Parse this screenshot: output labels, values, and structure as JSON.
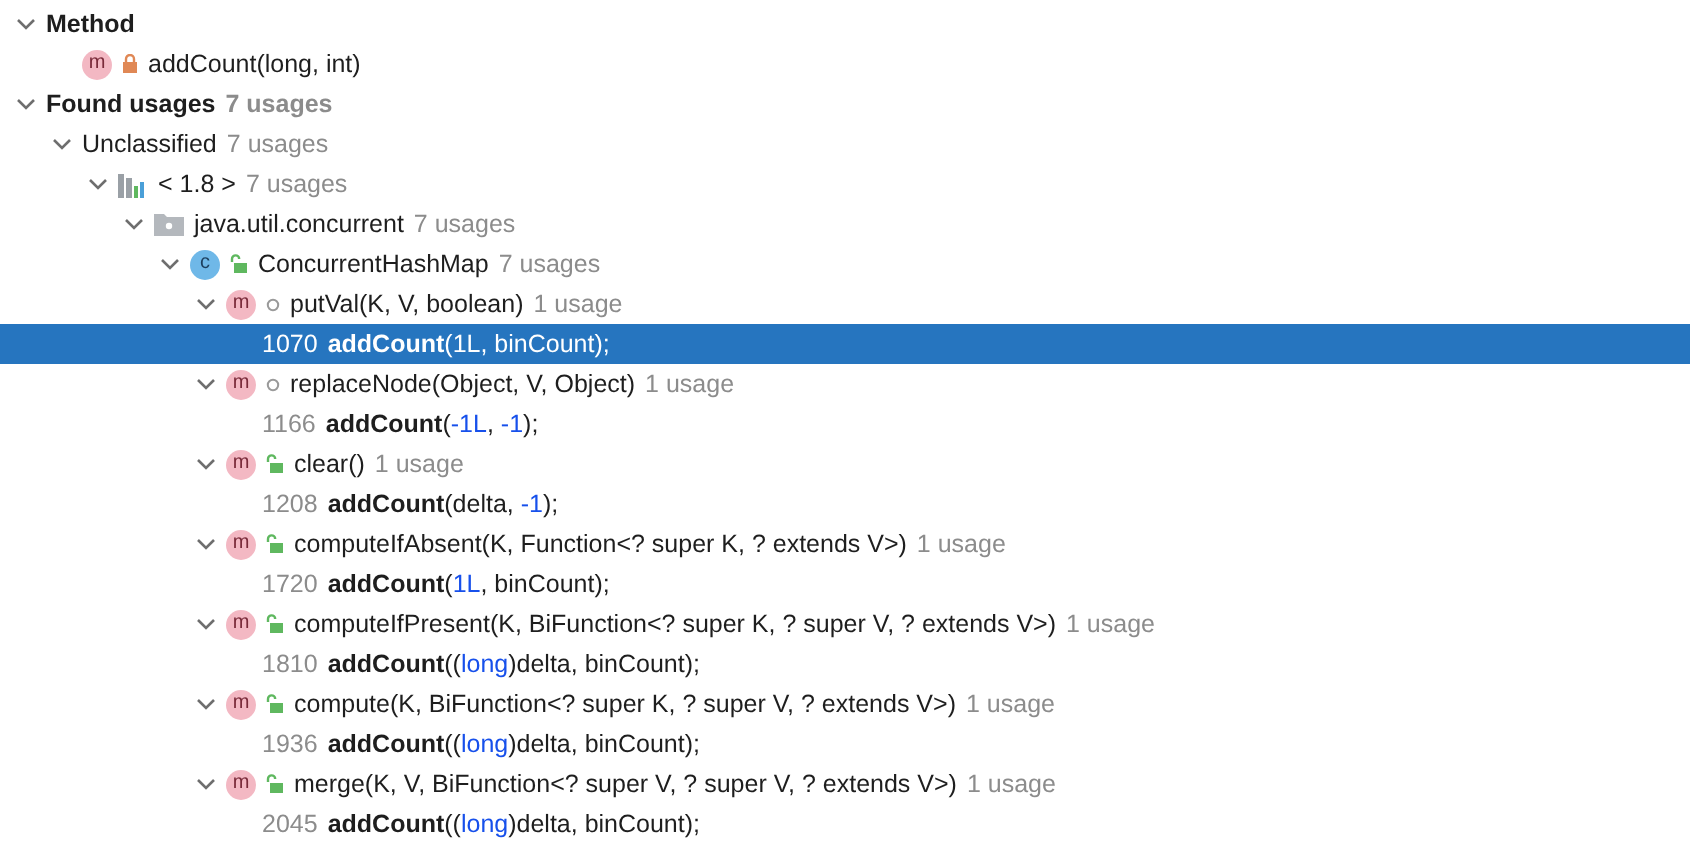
{
  "tree": [
    {
      "kind": "header",
      "label": "Method",
      "expanded": true,
      "selected": false,
      "children": [
        {
          "kind": "method",
          "badge": "m",
          "modifier": {
            "kind": "private"
          },
          "label": "addCount(long, int)",
          "selected": false
        }
      ]
    },
    {
      "kind": "header",
      "label": "Found usages",
      "count": "7 usages",
      "expanded": true,
      "selected": false,
      "children": [
        {
          "kind": "group",
          "label": "Unclassified",
          "count": "7 usages",
          "expanded": true,
          "selected": false,
          "children": [
            {
              "kind": "module",
              "label": "< 1.8 >",
              "count": "7 usages",
              "expanded": true,
              "selected": false,
              "children": [
                {
                  "kind": "package",
                  "label": "java.util.concurrent",
                  "count": "7 usages",
                  "expanded": true,
                  "selected": false,
                  "children": [
                    {
                      "kind": "class",
                      "badge": "c",
                      "modifier": {
                        "kind": "public"
                      },
                      "label": "ConcurrentHashMap",
                      "count": "7 usages",
                      "expanded": true,
                      "selected": false,
                      "children": [
                        {
                          "kind": "method",
                          "badge": "m",
                          "modifier": {
                            "kind": "package"
                          },
                          "label": "putVal(K, V, boolean)",
                          "count": "1 usage",
                          "expanded": true,
                          "selected": false,
                          "children": [
                            {
                              "kind": "usage",
                              "line": "1070",
                              "code": [
                                {
                                  "kind": "bold",
                                  "text": "addCount"
                                },
                                {
                                  "kind": "plain",
                                  "text": "("
                                },
                                {
                                  "kind": "literal",
                                  "text": "1L"
                                },
                                {
                                  "kind": "plain",
                                  "text": ", binCount);"
                                }
                              ],
                              "selected": true
                            }
                          ]
                        },
                        {
                          "kind": "method",
                          "badge": "m",
                          "modifier": {
                            "kind": "package"
                          },
                          "label": "replaceNode(Object, V, Object)",
                          "count": "1 usage",
                          "expanded": true,
                          "selected": false,
                          "children": [
                            {
                              "kind": "usage",
                              "line": "1166",
                              "code": [
                                {
                                  "kind": "bold",
                                  "text": "addCount"
                                },
                                {
                                  "kind": "plain",
                                  "text": "("
                                },
                                {
                                  "kind": "literal",
                                  "text": "-1L"
                                },
                                {
                                  "kind": "plain",
                                  "text": ", "
                                },
                                {
                                  "kind": "literal",
                                  "text": "-1"
                                },
                                {
                                  "kind": "plain",
                                  "text": ");"
                                }
                              ],
                              "selected": false
                            }
                          ]
                        },
                        {
                          "kind": "method",
                          "badge": "m",
                          "modifier": {
                            "kind": "public"
                          },
                          "label": "clear()",
                          "count": "1 usage",
                          "expanded": true,
                          "selected": false,
                          "children": [
                            {
                              "kind": "usage",
                              "line": "1208",
                              "code": [
                                {
                                  "kind": "bold",
                                  "text": "addCount"
                                },
                                {
                                  "kind": "plain",
                                  "text": "(delta, "
                                },
                                {
                                  "kind": "literal",
                                  "text": "-1"
                                },
                                {
                                  "kind": "plain",
                                  "text": ");"
                                }
                              ],
                              "selected": false
                            }
                          ]
                        },
                        {
                          "kind": "method",
                          "badge": "m",
                          "modifier": {
                            "kind": "public"
                          },
                          "label": "computeIfAbsent(K, Function<? super K, ? extends V>)",
                          "count": "1 usage",
                          "expanded": true,
                          "selected": false,
                          "children": [
                            {
                              "kind": "usage",
                              "line": "1720",
                              "code": [
                                {
                                  "kind": "bold",
                                  "text": "addCount"
                                },
                                {
                                  "kind": "plain",
                                  "text": "("
                                },
                                {
                                  "kind": "literal",
                                  "text": "1L"
                                },
                                {
                                  "kind": "plain",
                                  "text": ", binCount);"
                                }
                              ],
                              "selected": false
                            }
                          ]
                        },
                        {
                          "kind": "method",
                          "badge": "m",
                          "modifier": {
                            "kind": "public"
                          },
                          "label": "computeIfPresent(K, BiFunction<? super K, ? super V, ? extends V>)",
                          "count": "1 usage",
                          "expanded": true,
                          "selected": false,
                          "children": [
                            {
                              "kind": "usage",
                              "line": "1810",
                              "code": [
                                {
                                  "kind": "bold",
                                  "text": "addCount"
                                },
                                {
                                  "kind": "plain",
                                  "text": "(("
                                },
                                {
                                  "kind": "keyword",
                                  "text": "long"
                                },
                                {
                                  "kind": "plain",
                                  "text": ")delta, binCount);"
                                }
                              ],
                              "selected": false
                            }
                          ]
                        },
                        {
                          "kind": "method",
                          "badge": "m",
                          "modifier": {
                            "kind": "public"
                          },
                          "label": "compute(K, BiFunction<? super K, ? super V, ? extends V>)",
                          "count": "1 usage",
                          "expanded": true,
                          "selected": false,
                          "children": [
                            {
                              "kind": "usage",
                              "line": "1936",
                              "code": [
                                {
                                  "kind": "bold",
                                  "text": "addCount"
                                },
                                {
                                  "kind": "plain",
                                  "text": "(("
                                },
                                {
                                  "kind": "keyword",
                                  "text": "long"
                                },
                                {
                                  "kind": "plain",
                                  "text": ")delta, binCount);"
                                }
                              ],
                              "selected": false
                            }
                          ]
                        },
                        {
                          "kind": "method",
                          "badge": "m",
                          "modifier": {
                            "kind": "public"
                          },
                          "label": "merge(K, V, BiFunction<? super V, ? super V, ? extends V>)",
                          "count": "1 usage",
                          "expanded": true,
                          "selected": false,
                          "children": [
                            {
                              "kind": "usage",
                              "line": "2045",
                              "code": [
                                {
                                  "kind": "bold",
                                  "text": "addCount"
                                },
                                {
                                  "kind": "plain",
                                  "text": "(("
                                },
                                {
                                  "kind": "keyword",
                                  "text": "long"
                                },
                                {
                                  "kind": "plain",
                                  "text": ")delta, binCount);"
                                }
                              ],
                              "selected": false
                            }
                          ]
                        }
                      ]
                    }
                  ]
                }
              ]
            }
          ]
        }
      ]
    }
  ]
}
